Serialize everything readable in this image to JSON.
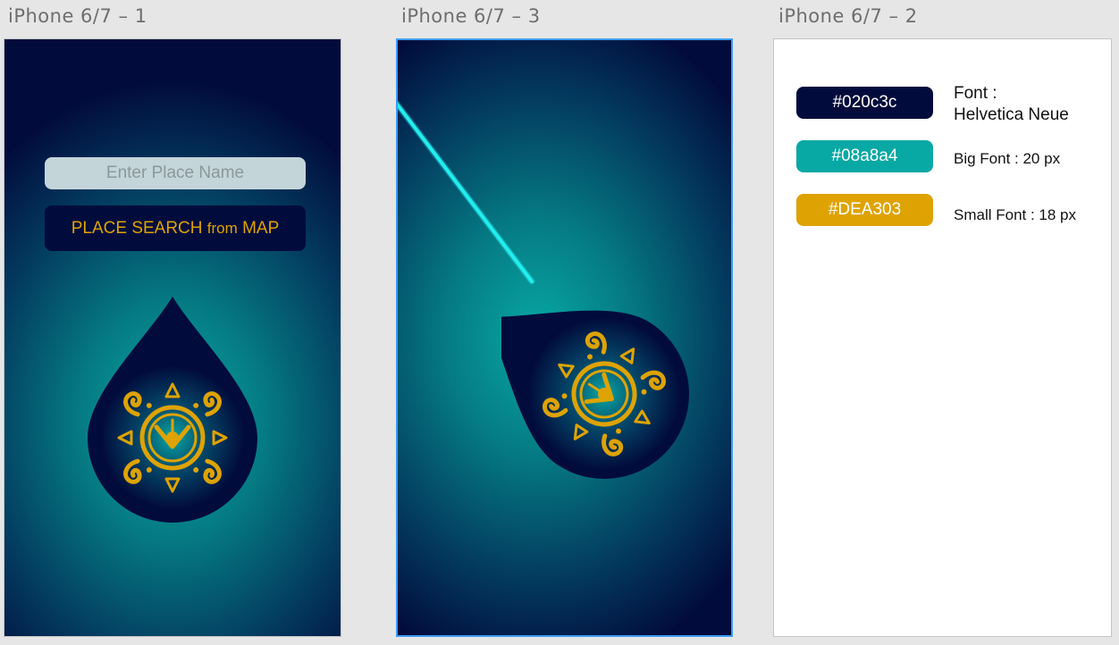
{
  "artboards": [
    {
      "title": "iPhone 6/7 – 1"
    },
    {
      "title": "iPhone 6/7 – 3"
    },
    {
      "title": "iPhone 6/7 – 2"
    }
  ],
  "screen1": {
    "input_placeholder": "Enter Place Name",
    "search_button": {
      "prefix": "PLACE SEARCH",
      "middle": "from",
      "suffix": "MAP"
    }
  },
  "style_guide": {
    "swatches": [
      {
        "label": "#020c3c",
        "color": "#020c3c"
      },
      {
        "label": "#08a8a4",
        "color": "#08a8a4"
      },
      {
        "label": "#DEA303",
        "color": "#DEA303"
      }
    ],
    "font_label": "Font  :",
    "font_name": "Helvetica Neue",
    "big_font": "Big Font  : 20 px",
    "small_font": "Small Font  : 18 px"
  },
  "colors": {
    "dark_navy": "#020c3c",
    "teal": "#08a8a4",
    "gold": "#DEA303",
    "beam": "#22eeee",
    "selection": "#3d9cf5"
  },
  "icons": [
    "drop-emblem-icon",
    "light-beam"
  ]
}
